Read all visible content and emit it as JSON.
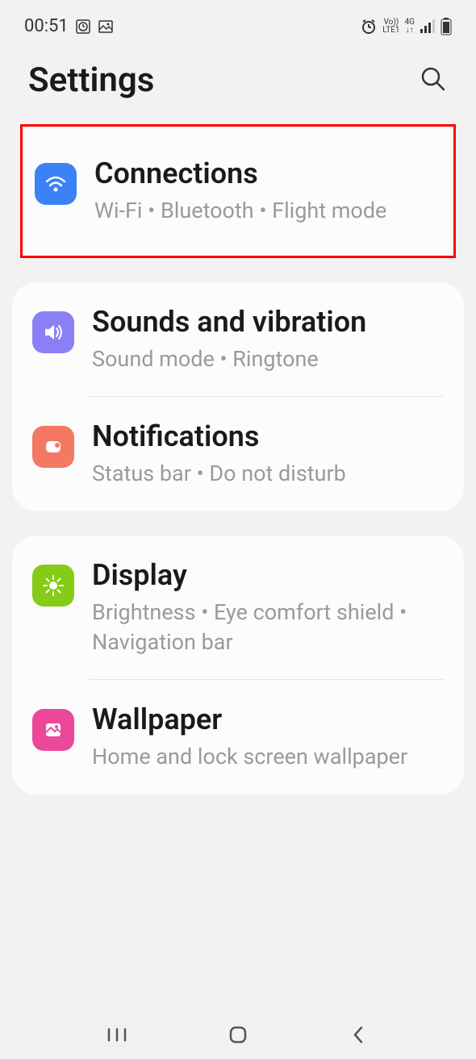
{
  "statusBar": {
    "time": "00:51",
    "volte": "Vo))",
    "lte": "LTE1",
    "network": "4G"
  },
  "header": {
    "title": "Settings"
  },
  "sections": [
    {
      "title": "Connections",
      "subtitle": "Wi-Fi  •  Bluetooth  •  Flight mode"
    },
    {
      "title": "Sounds and vibration",
      "subtitle": "Sound mode  •  Ringtone"
    },
    {
      "title": "Notifications",
      "subtitle": "Status bar  •  Do not disturb"
    },
    {
      "title": "Display",
      "subtitle": "Brightness  •  Eye comfort shield  •  Navigation bar"
    },
    {
      "title": "Wallpaper",
      "subtitle": "Home and lock screen wallpaper"
    }
  ]
}
